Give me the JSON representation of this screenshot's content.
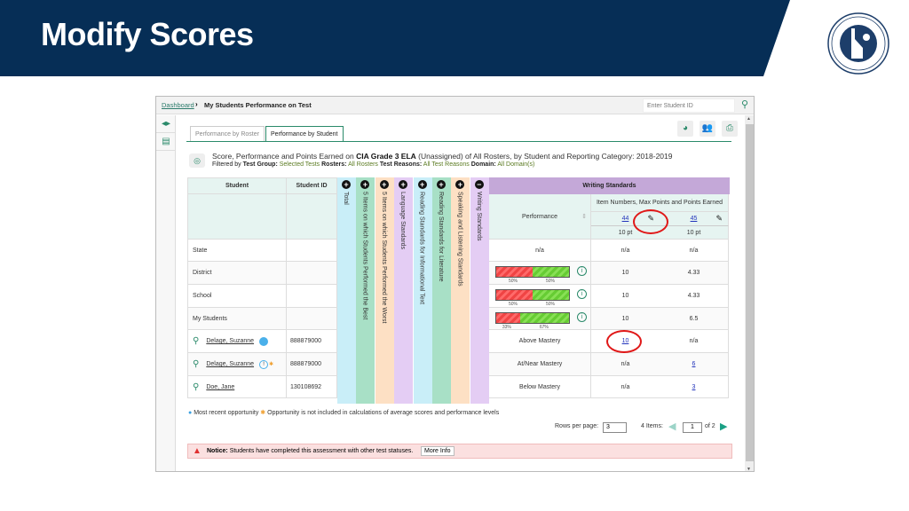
{
  "slide": {
    "title": "Modify Scores",
    "seal_text_top": "DEPARTMENT OF EDUCATION",
    "seal_text_bottom": "STATE OF IDAHO"
  },
  "app": {
    "breadcrumb": {
      "link": "Dashboard",
      "separator": "›",
      "current": "My Students Performance on Test"
    },
    "search": {
      "placeholder": "Enter Student ID",
      "icon": "search-icon"
    },
    "sidebar": [
      {
        "icon": "expand-collapse-icon"
      },
      {
        "icon": "clipboard-icon"
      }
    ],
    "tabs": [
      {
        "label": "Performance by Roster",
        "active": false
      },
      {
        "label": "Performance by Student",
        "active": true
      }
    ],
    "tools": [
      {
        "icon": "pie-chart-icon"
      },
      {
        "icon": "users-icon"
      },
      {
        "icon": "print-icon"
      }
    ],
    "report_title": {
      "prefix": "Score, Performance and Points Earned on ",
      "test": "CIA Grade 3 ELA",
      "suffix": " (Unassigned) of All Rosters, by Student and Reporting Category: 2018-2019"
    },
    "filters": {
      "lead": "Filtered by",
      "items": [
        {
          "label": "Test Group:",
          "value": "Selected Tests"
        },
        {
          "label": "Rosters:",
          "value": "All Rosters"
        },
        {
          "label": "Test Reasons:",
          "value": "All Test Reasons"
        },
        {
          "label": "Domain:",
          "value": "All Domain(s)"
        }
      ]
    },
    "table": {
      "col_student": "Student",
      "col_student_id": "Student ID",
      "categories": [
        {
          "label": "Total",
          "color": "#c9eef8",
          "expanded": false
        },
        {
          "label": "5 Items on which Students Performed the Best",
          "color": "#a8e0c6",
          "expanded": false
        },
        {
          "label": "5 Items on which Students Performed the Worst",
          "color": "#fde0c4",
          "expanded": false
        },
        {
          "label": "Language Standards",
          "color": "#e4cdf4",
          "expanded": false
        },
        {
          "label": "Reading Standards for Informational Text",
          "color": "#c9eef8",
          "expanded": false
        },
        {
          "label": "Reading Standards for Literature",
          "color": "#a8e0c6",
          "expanded": false
        },
        {
          "label": "Speaking and Listening Standards",
          "color": "#fde0c4",
          "expanded": false
        },
        {
          "label": "Writing Standards",
          "color": "#e4cdf4",
          "expanded": true
        }
      ],
      "writing": {
        "title": "Writing Standards",
        "performance_label": "Performance",
        "items_label": "Item Numbers, Max Points and Points Earned",
        "items": [
          {
            "number": "44",
            "max": "10 pt"
          },
          {
            "number": "45",
            "max": "10 pt"
          }
        ]
      },
      "rows": [
        {
          "name": "State",
          "id": "",
          "kind": "agg",
          "performance": "n/a",
          "bar": null,
          "i44": "n/a",
          "i45": "n/a"
        },
        {
          "name": "District",
          "id": "",
          "kind": "agg",
          "performance": "",
          "bar": {
            "red": 50,
            "green": 50
          },
          "i44": "10",
          "i45": "4.33"
        },
        {
          "name": "School",
          "id": "",
          "kind": "agg",
          "performance": "",
          "bar": {
            "red": 50,
            "green": 50
          },
          "i44": "10",
          "i45": "4.33"
        },
        {
          "name": "My Students",
          "id": "",
          "kind": "agg",
          "performance": "",
          "bar": {
            "red": 33,
            "green": 67
          },
          "i44": "10",
          "i45": "6.5"
        },
        {
          "name": "Delage, Suzanne",
          "id": "888879000",
          "kind": "student",
          "badge": "most-recent",
          "performance": "Above Mastery",
          "bar": null,
          "i44": "10",
          "i45": "n/a",
          "i44_link": true,
          "i45_link": false
        },
        {
          "name": "Delage, Suzanne",
          "id": "888879000",
          "kind": "student",
          "badge": "excluded",
          "performance": "At/Near Mastery",
          "bar": null,
          "i44": "n/a",
          "i45": "6",
          "i44_link": false,
          "i45_link": true
        },
        {
          "name": "Doe, Jane",
          "id": "130108692",
          "kind": "student",
          "badge": "",
          "performance": "Below Mastery",
          "bar": null,
          "i44": "n/a",
          "i45": "3",
          "i44_link": false,
          "i45_link": true
        }
      ]
    },
    "legend": {
      "most_recent": "Most recent opportunity",
      "excluded": "Opportunity is not included in calculations of average scores and performance levels"
    },
    "pager": {
      "rows_label": "Rows per page:",
      "rows_value": "3",
      "items": "4 Items:",
      "page": "1",
      "of": "of 2"
    },
    "notice": {
      "label": "Notice:",
      "text": "Students have completed this assessment with other test statuses.",
      "button": "More Info"
    }
  },
  "bar_labels": {
    "d": [
      "50%",
      "50%"
    ],
    "s": [
      "50%",
      "50%"
    ],
    "m": [
      "33%",
      "67%"
    ]
  }
}
